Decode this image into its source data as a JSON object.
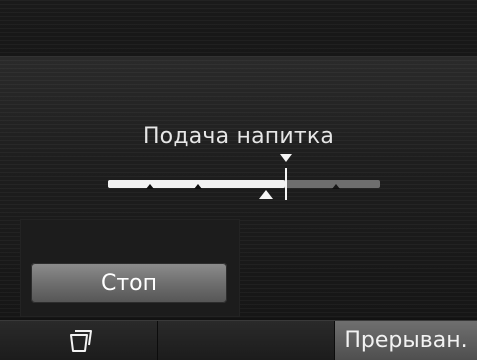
{
  "screen": {
    "title": "Подача напитка"
  },
  "slider": {
    "progress": 0.58,
    "target": 0.65
  },
  "controls": {
    "stop_label": "Стоп"
  },
  "bottom_bar": {
    "interrupt_label": "Прерыван.",
    "left_icon": "cup-icon"
  }
}
